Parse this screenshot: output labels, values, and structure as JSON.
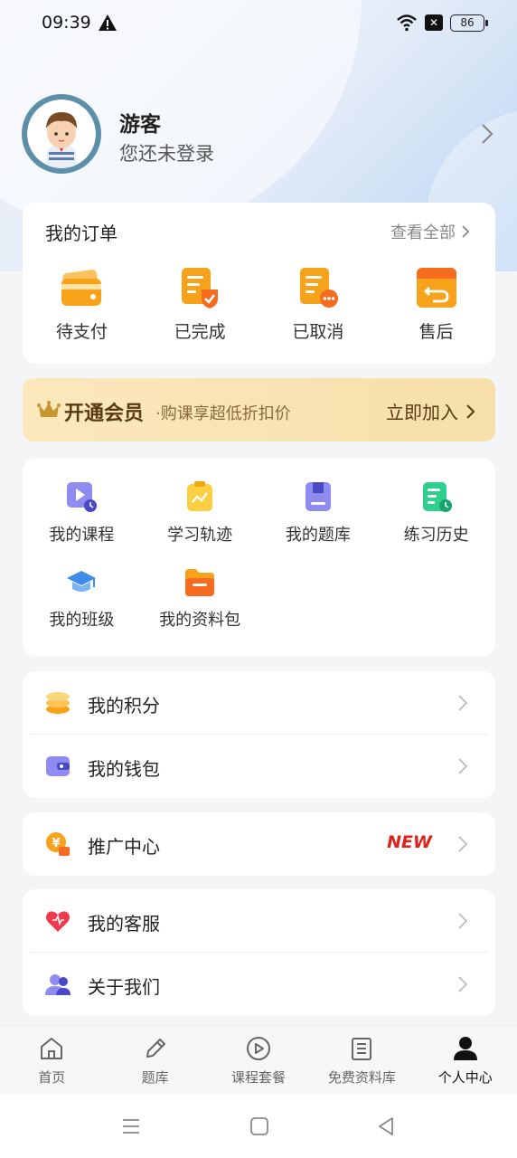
{
  "status_bar": {
    "time": "09:39",
    "battery": "86",
    "x_icon": "✕"
  },
  "profile": {
    "name": "游客",
    "login_tip": "您还未登录"
  },
  "orders": {
    "title": "我的订单",
    "view_all": "查看全部",
    "items": [
      {
        "label": "待支付",
        "icon": "wallet-icon"
      },
      {
        "label": "已完成",
        "icon": "order-complete-icon"
      },
      {
        "label": "已取消",
        "icon": "order-cancel-icon"
      },
      {
        "label": "售后",
        "icon": "after-sale-icon"
      }
    ]
  },
  "vip": {
    "title": "开通会员",
    "subtitle": "·购课享超低折扣价",
    "join": "立即加入"
  },
  "tools": [
    {
      "label": "我的课程",
      "icon": "course-icon"
    },
    {
      "label": "学习轨迹",
      "icon": "trajectory-icon"
    },
    {
      "label": "我的题库",
      "icon": "question-bank-icon"
    },
    {
      "label": "练习历史",
      "icon": "practice-history-icon"
    },
    {
      "label": "我的班级",
      "icon": "class-icon"
    },
    {
      "label": "我的资料包",
      "icon": "materials-icon"
    }
  ],
  "points_list": [
    {
      "label": "我的积分",
      "icon": "coins-icon"
    },
    {
      "label": "我的钱包",
      "icon": "wallet-icon"
    }
  ],
  "promo": {
    "label": "推广中心",
    "badge": "NEW",
    "icon": "promotion-icon"
  },
  "service_list": [
    {
      "label": "我的客服",
      "icon": "heart-icon"
    },
    {
      "label": "关于我们",
      "icon": "about-icon"
    }
  ],
  "bottom_nav": [
    {
      "label": "首页",
      "icon": "home-icon"
    },
    {
      "label": "题库",
      "icon": "pencil-icon"
    },
    {
      "label": "课程套餐",
      "icon": "play-icon"
    },
    {
      "label": "免费资料库",
      "icon": "list-icon"
    },
    {
      "label": "个人中心",
      "icon": "person-icon",
      "active": true
    }
  ],
  "colors": {
    "accent_orange": "#f7a21b",
    "vip_gold": "#f6dfaa",
    "new_red": "#e0201b"
  }
}
